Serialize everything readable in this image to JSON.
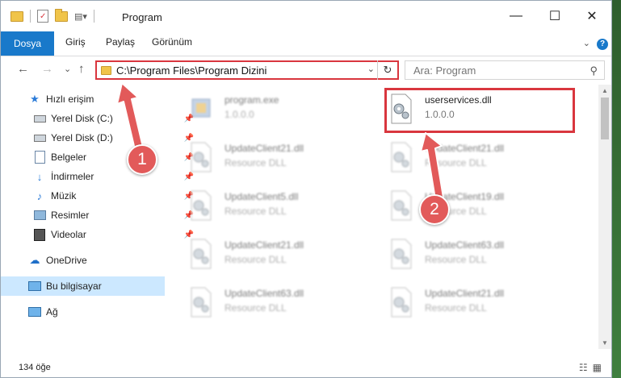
{
  "window": {
    "title": "Program",
    "buttons": {
      "minimize": "—",
      "maximize": "☐",
      "close": "✕"
    }
  },
  "ribbon": {
    "tabs": [
      "Dosya",
      "Giriş",
      "Paylaş",
      "Görünüm"
    ],
    "help": "?"
  },
  "nav": {
    "back": "←",
    "forward": "→",
    "recent": "⌄",
    "up": "↑"
  },
  "address": {
    "path": "C:\\Program Files\\Program Dizini",
    "dropdown": "⌄",
    "refresh": "↻"
  },
  "search": {
    "placeholder": "Ara: Program",
    "icon": "⚲"
  },
  "sidebar": {
    "items": [
      {
        "label": "Hızlı erişim",
        "icon": "star-icon"
      },
      {
        "label": "Yerel Disk (C:)",
        "icon": "drive-icon"
      },
      {
        "label": "Yerel Disk (D:)",
        "icon": "drive-icon"
      },
      {
        "label": "Belgeler",
        "icon": "document-icon"
      },
      {
        "label": "İndirmeler",
        "icon": "download-icon"
      },
      {
        "label": "Müzik",
        "icon": "music-icon"
      },
      {
        "label": "Resimler",
        "icon": "picture-icon"
      },
      {
        "label": "Videolar",
        "icon": "video-icon"
      },
      {
        "label": "OneDrive",
        "icon": "cloud-icon"
      },
      {
        "label": "Bu bilgisayar",
        "icon": "computer-icon"
      },
      {
        "label": "Ağ",
        "icon": "network-icon"
      }
    ]
  },
  "files": [
    {
      "name": "program.exe",
      "sub": "1.0.0.0"
    },
    {
      "name": "userservices.dll",
      "sub": "1.0.0.0"
    },
    {
      "name": "UpdateClient21.dll",
      "sub": "Resource DLL"
    },
    {
      "name": "UpdateClient21.dll",
      "sub": "Resource DLL"
    },
    {
      "name": "UpdateClient5.dll",
      "sub": "Resource DLL"
    },
    {
      "name": "UpdateClient19.dll",
      "sub": "Resource DLL"
    },
    {
      "name": "UpdateClient21.dll",
      "sub": "Resource DLL"
    },
    {
      "name": "UpdateClient63.dll",
      "sub": "Resource DLL"
    },
    {
      "name": "UpdateClient63.dll",
      "sub": "Resource DLL"
    },
    {
      "name": "UpdateClient21.dll",
      "sub": "Resource DLL"
    }
  ],
  "annotations": {
    "step1": "1",
    "step2": "2",
    "color": "#e25a5a"
  },
  "status": {
    "count": "134 öğe"
  }
}
